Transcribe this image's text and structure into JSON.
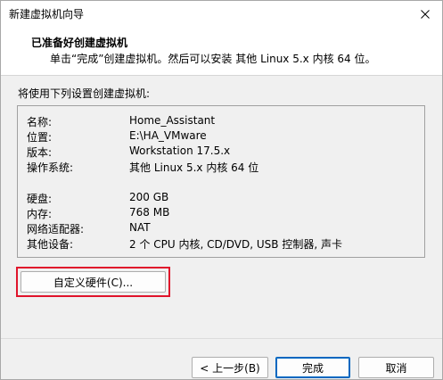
{
  "window": {
    "title": "新建虚拟机向导"
  },
  "header": {
    "title": "已准备好创建虚拟机",
    "subtitle": "单击“完成”创建虚拟机。然后可以安装 其他 Linux 5.x 内核 64 位。"
  },
  "summary": {
    "label": "将使用下列设置创建虚拟机:",
    "rows": [
      {
        "key": "名称:",
        "value": "Home_Assistant"
      },
      {
        "key": "位置:",
        "value": "E:\\HA_VMware"
      },
      {
        "key": "版本:",
        "value": "Workstation 17.5.x"
      },
      {
        "key": "操作系统:",
        "value": "其他 Linux 5.x 内核 64 位"
      },
      {
        "key": "硬盘:",
        "value": "200 GB"
      },
      {
        "key": "内存:",
        "value": "768 MB"
      },
      {
        "key": "网络适配器:",
        "value": "NAT"
      },
      {
        "key": "其他设备:",
        "value": "2 个 CPU 内核, CD/DVD, USB 控制器, 声卡"
      }
    ]
  },
  "buttons": {
    "customize_hardware": "自定义硬件(C)...",
    "back": "< 上一步(B)",
    "finish": "完成",
    "cancel": "取消"
  },
  "icons": {
    "close": "close-icon"
  },
  "colors": {
    "highlight": "#e0142b",
    "default_button_border": "#0067c0"
  }
}
